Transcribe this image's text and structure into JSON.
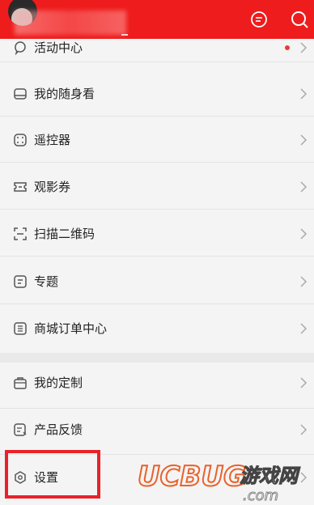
{
  "header": {
    "bg_color": "#ee1c1c",
    "message_icon": "message-icon",
    "search_icon": "search-icon"
  },
  "menu": {
    "items": [
      {
        "label": "活动中心",
        "icon": "bubble-icon",
        "has_dot": true
      },
      {
        "label": "我的随身看",
        "icon": "tray-icon"
      },
      {
        "label": "遥控器",
        "icon": "remote-icon"
      },
      {
        "label": "观影券",
        "icon": "ticket-icon"
      },
      {
        "label": "扫描二维码",
        "icon": "scan-icon"
      },
      {
        "label": "专题",
        "icon": "topic-icon"
      },
      {
        "label": "商城订单中心",
        "icon": "order-icon"
      },
      {
        "label": "我的定制",
        "icon": "custom-icon"
      },
      {
        "label": "产品反馈",
        "icon": "feedback-icon"
      },
      {
        "label": "设置",
        "icon": "settings-icon"
      }
    ]
  },
  "watermark": {
    "brand_text": "UCBUG",
    "site_text": "游戏网",
    "domain_text": ".com"
  }
}
